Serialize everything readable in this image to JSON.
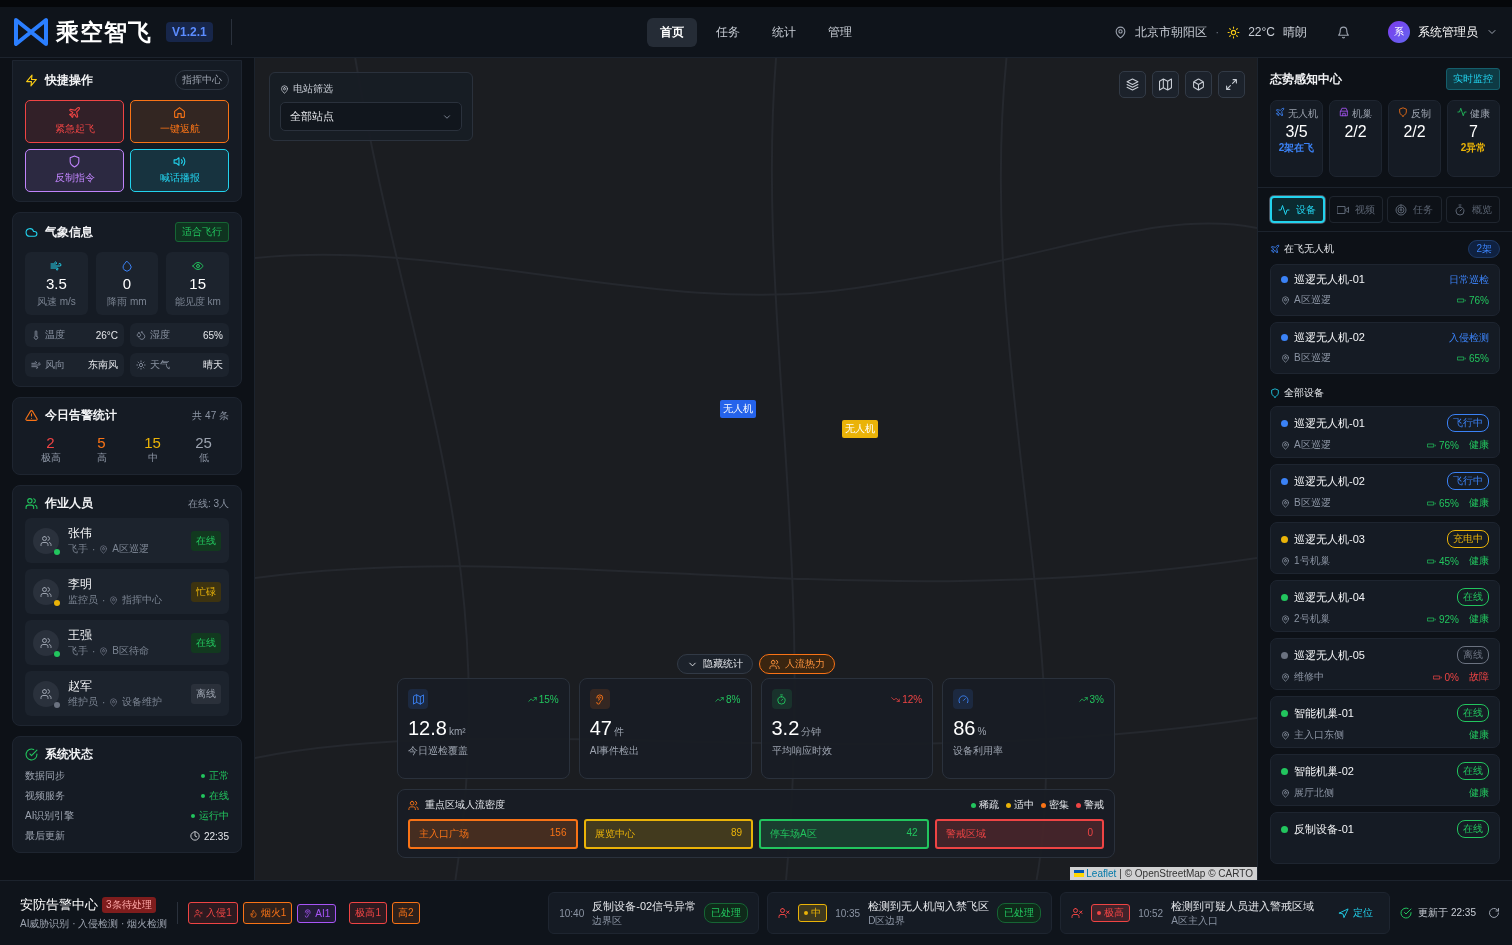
{
  "header": {
    "logo": "乘空智飞",
    "version": "V1.2.1",
    "nav": [
      {
        "label": "首页",
        "selected": true
      },
      {
        "label": "任务",
        "selected": false
      },
      {
        "label": "统计",
        "selected": false
      },
      {
        "label": "管理",
        "selected": false
      }
    ],
    "location": "北京市朝阳区",
    "separator": "·",
    "temperature": "22°C",
    "weather": "晴朗",
    "user": {
      "avatar": "系",
      "name": "系统管理员"
    }
  },
  "quick_actions": {
    "title": "快捷操作",
    "badge": "指挥中心",
    "buttons": [
      {
        "label": "紧急起飞",
        "kind": "plane",
        "color": "#ef4444"
      },
      {
        "label": "一键返航",
        "kind": "home",
        "color": "#f97316"
      },
      {
        "label": "反制指令",
        "kind": "shield",
        "color": "#c084fc"
      },
      {
        "label": "喊话播报",
        "kind": "speaker",
        "color": "#22d3ee"
      }
    ]
  },
  "weather": {
    "title": "气象信息",
    "badge": "适合飞行",
    "metrics": [
      {
        "kind": "wind",
        "value": "3.5",
        "label": "风速 m/s"
      },
      {
        "kind": "drop",
        "value": "0",
        "label": "降雨 mm"
      },
      {
        "kind": "eye",
        "value": "15",
        "label": "能见度 km"
      }
    ],
    "details": [
      {
        "kind": "thermo",
        "label": "温度",
        "value": "26°C"
      },
      {
        "kind": "humidity",
        "label": "湿度",
        "value": "65%"
      },
      {
        "kind": "wind",
        "label": "风向",
        "value": "东南风"
      },
      {
        "kind": "sun",
        "label": "天气",
        "value": "晴天"
      }
    ]
  },
  "alerts_today": {
    "title": "今日告警统计",
    "total": "共 47 条",
    "levels": [
      {
        "value": "2",
        "label": "极高",
        "color": "#ef4444"
      },
      {
        "value": "5",
        "label": "高",
        "color": "#f97316"
      },
      {
        "value": "15",
        "label": "中",
        "color": "#eab308"
      },
      {
        "value": "25",
        "label": "低",
        "color": "#9ca3af"
      }
    ]
  },
  "staff": {
    "title": "作业人员",
    "online": "在线: 3人",
    "separator": "·",
    "people": [
      {
        "name": "张伟",
        "role": "飞手",
        "place": "A区巡逻",
        "status": "在线",
        "kind": "online"
      },
      {
        "name": "李明",
        "role": "监控员",
        "place": "指挥中心",
        "status": "忙碌",
        "kind": "busy"
      },
      {
        "name": "王强",
        "role": "飞手",
        "place": "B区待命",
        "status": "在线",
        "kind": "online"
      },
      {
        "name": "赵军",
        "role": "维护员",
        "place": "设备维护",
        "status": "离线",
        "kind": "offline"
      }
    ]
  },
  "system_status": {
    "title": "系统状态",
    "rows": [
      {
        "label": "数据同步",
        "value": "正常",
        "kind": "ok"
      },
      {
        "label": "视频服务",
        "value": "在线",
        "kind": "ok"
      },
      {
        "label": "AI识别引擎",
        "value": "运行中",
        "kind": "ok"
      },
      {
        "label": "最后更新",
        "value": "22:35",
        "kind": "time"
      }
    ]
  },
  "map": {
    "filter": {
      "label": "电站筛选",
      "value": "全部站点"
    },
    "markers": [
      {
        "label": "无人机",
        "color": "#2563eb"
      },
      {
        "label": "无人机",
        "color": "#eab308"
      }
    ],
    "toggle_stats": "隐藏统计",
    "heatmap": {
      "label": "人流热力",
      "on": true
    },
    "stats": [
      {
        "kind": "map",
        "value": "12.8",
        "unit": "km²",
        "label": "今日巡检覆盖",
        "trend": "15%",
        "up": true
      },
      {
        "kind": "ai",
        "value": "47",
        "unit": "件",
        "label": "AI事件检出",
        "trend": "8%",
        "up": true
      },
      {
        "kind": "timer",
        "value": "3.2",
        "unit": "分钟",
        "label": "平均响应时效",
        "trend": "12%",
        "up": false
      },
      {
        "kind": "gauge",
        "value": "86",
        "unit": "%",
        "label": "设备利用率",
        "trend": "3%",
        "up": true
      }
    ],
    "density": {
      "title": "重点区域人流密度",
      "legend": [
        {
          "label": "稀疏",
          "color": "#22c55e"
        },
        {
          "label": "适中",
          "color": "#eab308"
        },
        {
          "label": "密集",
          "color": "#f97316"
        },
        {
          "label": "警戒",
          "color": "#ef4444"
        }
      ],
      "zones": [
        {
          "name": "主入口广场",
          "count": "156",
          "color": "#f97316"
        },
        {
          "name": "展览中心",
          "count": "89",
          "color": "#eab308"
        },
        {
          "name": "停车场A区",
          "count": "42",
          "color": "#22c55e"
        },
        {
          "name": "警戒区域",
          "count": "0",
          "color": "#ef4444"
        }
      ]
    },
    "attribution": {
      "link": "Leaflet",
      "text": "| © OpenStreetMap © CARTO"
    }
  },
  "situation": {
    "title": "态势感知中心",
    "badge": "实时监控",
    "summary": [
      {
        "kind": "drone",
        "label": "无人机",
        "value": "3/5",
        "note": "2架在飞",
        "color": "#3b82f6"
      },
      {
        "kind": "nest",
        "label": "机巢",
        "value": "2/2"
      },
      {
        "kind": "shield",
        "label": "反制",
        "value": "2/2"
      },
      {
        "kind": "pulse",
        "label": "健康",
        "value": "7",
        "note": "2异常",
        "color": "#eab308"
      }
    ],
    "tabs": [
      {
        "label": "设备",
        "kind": "pulse",
        "selected": true
      },
      {
        "label": "视频",
        "kind": "camera",
        "selected": false
      },
      {
        "label": "任务",
        "kind": "target",
        "selected": false
      },
      {
        "label": "概览",
        "kind": "timer",
        "selected": false
      }
    ],
    "flying": {
      "title": "在飞无人机",
      "count": "2架",
      "items": [
        {
          "name": "巡逻无人机-01",
          "place": "A区巡逻",
          "task": "日常巡检",
          "battery": "76%"
        },
        {
          "name": "巡逻无人机-02",
          "place": "B区巡逻",
          "task": "入侵检测",
          "battery": "65%"
        }
      ]
    },
    "devices": {
      "title": "全部设备",
      "items": [
        {
          "name": "巡逻无人机-01",
          "place": "A区巡逻",
          "status": "飞行中",
          "color": "#3b82f6",
          "battery": "76%",
          "health": "健康",
          "fault": false
        },
        {
          "name": "巡逻无人机-02",
          "place": "B区巡逻",
          "status": "飞行中",
          "color": "#3b82f6",
          "battery": "65%",
          "health": "健康",
          "fault": false
        },
        {
          "name": "巡逻无人机-03",
          "place": "1号机巢",
          "status": "充电中",
          "color": "#eab308",
          "battery": "45%",
          "health": "健康",
          "fault": false
        },
        {
          "name": "巡逻无人机-04",
          "place": "2号机巢",
          "status": "在线",
          "color": "#22c55e",
          "battery": "92%",
          "health": "健康",
          "fault": false
        },
        {
          "name": "巡逻无人机-05",
          "place": "维修中",
          "status": "离线",
          "color": "#6b7280",
          "battery": "0%",
          "health": "故障",
          "fault": true
        },
        {
          "name": "智能机巢-01",
          "place": "主入口东侧",
          "status": "在线",
          "color": "#22c55e",
          "health": "健康",
          "fault": false
        },
        {
          "name": "智能机巢-02",
          "place": "展厅北侧",
          "status": "在线",
          "color": "#22c55e",
          "health": "健康",
          "fault": false
        },
        {
          "name": "反制设备-01",
          "status": "在线",
          "color": "#22c55e"
        }
      ]
    }
  },
  "alert_bar": {
    "title": "安防告警中心",
    "pending": "3条待处理",
    "subtitle": "AI威胁识别 · 入侵检测 · 烟火检测",
    "chips": [
      {
        "label": "入侵1",
        "kind": "intrusion",
        "color": "#ef4444"
      },
      {
        "label": "烟火1",
        "kind": "fire",
        "color": "#f97316"
      },
      {
        "label": "AI1",
        "kind": "ai",
        "color": "#a855f7"
      },
      {
        "label": "极高1",
        "kind": "plain",
        "color": "#ef4444"
      },
      {
        "label": "高2",
        "kind": "plain",
        "color": "#f97316"
      }
    ],
    "events": [
      {
        "time": "10:40",
        "title": "反制设备-02信号异常",
        "place": "边界区",
        "action": {
          "label": "已处理",
          "kind": "done"
        }
      },
      {
        "level": {
          "label": "中",
          "color": "#eab308"
        },
        "time": "10:35",
        "title": "检测到无人机闯入禁飞区",
        "place": "D区边界",
        "action": {
          "label": "已处理",
          "kind": "done"
        }
      },
      {
        "level": {
          "label": "极高",
          "color": "#ef4444"
        },
        "time": "10:52",
        "title": "检测到可疑人员进入警戒区域",
        "place": "A区主入口",
        "action": {
          "label": "定位",
          "kind": "locate"
        }
      }
    ],
    "updated": "更新于 22:35"
  }
}
